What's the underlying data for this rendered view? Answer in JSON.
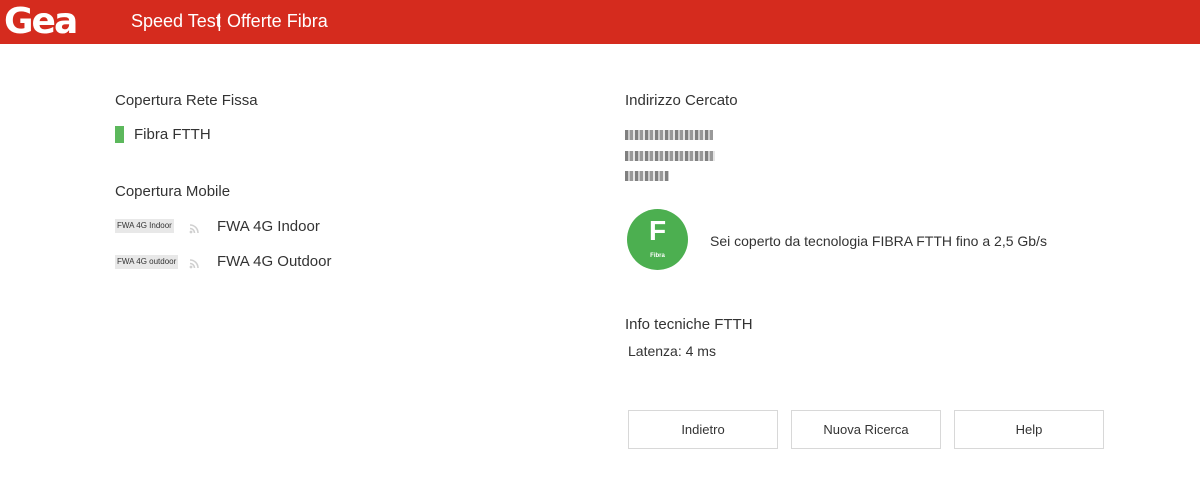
{
  "header": {
    "logo_text": "Gea",
    "nav": [
      "Speed Test",
      "Offerte Fibra"
    ],
    "separator": "|"
  },
  "colors": {
    "header_bg": "#d52b1e",
    "fiber_green": "#5cb85c",
    "badge_green": "#4caf50"
  },
  "left": {
    "fixed_title": "Copertura Rete Fissa",
    "fixed_items": [
      {
        "label": "Fibra FTTH",
        "icon": "green-bar"
      }
    ],
    "mobile_title": "Copertura Mobile",
    "mobile_items": [
      {
        "tag": "FWA 4G Indoor",
        "label": "FWA 4G Indoor",
        "icon": "wifi-icon"
      },
      {
        "tag": "FWA 4G outdoor",
        "label": "FWA 4G Outdoor",
        "icon": "wifi-icon"
      }
    ]
  },
  "right": {
    "address_title": "Indirizzo Cercato",
    "coverage": {
      "badge_letter": "F",
      "badge_caption": "Fibra",
      "message": "Sei coperto da tecnologia FIBRA FTTH fino a 2,5 Gb/s"
    },
    "tech_title": "Info tecniche FTTH",
    "latency": "Latenza: 4 ms"
  },
  "buttons": {
    "back": "Indietro",
    "new_search": "Nuova Ricerca",
    "help": "Help"
  }
}
